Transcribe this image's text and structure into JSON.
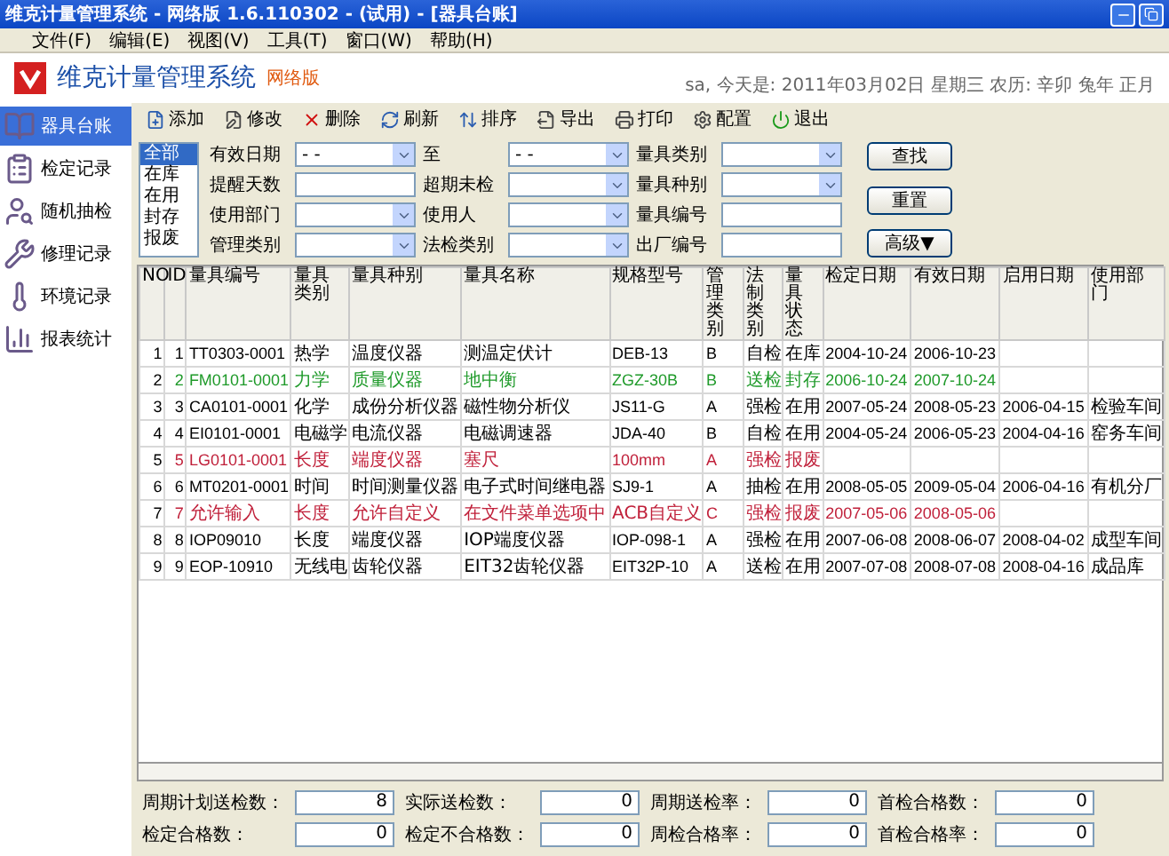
{
  "window": {
    "title": "维克计量管理系统 - 网络版 1.6.110302 - (试用) - [器具台账]"
  },
  "menu": [
    "文件(F)",
    "编辑(E)",
    "视图(V)",
    "工具(T)",
    "窗口(W)",
    "帮助(H)"
  ],
  "header": {
    "app_name": "维克计量管理系统",
    "edition": "网络版",
    "today": "sa, 今天是: 2011年03月02日 星期三  农历: 辛卯 兔年 正月"
  },
  "sidebar": [
    {
      "label": "器具台账",
      "selected": true
    },
    {
      "label": "检定记录",
      "selected": false
    },
    {
      "label": "随机抽检",
      "selected": false
    },
    {
      "label": "修理记录",
      "selected": false
    },
    {
      "label": "环境记录",
      "selected": false
    },
    {
      "label": "报表统计",
      "selected": false
    }
  ],
  "toolbar": [
    "添加",
    "修改",
    "删除",
    "刷新",
    "排序",
    "导出",
    "打印",
    "配置",
    "退出"
  ],
  "status_filter": [
    {
      "label": "全部",
      "selected": true
    },
    {
      "label": "在库",
      "selected": false
    },
    {
      "label": "在用",
      "selected": false
    },
    {
      "label": "封存",
      "selected": false
    },
    {
      "label": "报废",
      "selected": false
    }
  ],
  "filters": [
    {
      "label": "有效日期",
      "kind": "select",
      "value": "-  -"
    },
    {
      "label": "至",
      "kind": "select",
      "value": "-  -"
    },
    {
      "label": "量具类别",
      "kind": "select"
    },
    {
      "label": "提醒天数",
      "kind": "input"
    },
    {
      "label": "超期未检",
      "kind": "select"
    },
    {
      "label": "量具种别",
      "kind": "select"
    },
    {
      "label": "使用部门",
      "kind": "select"
    },
    {
      "label": "使用人",
      "kind": "select"
    },
    {
      "label": "量具编号",
      "kind": "input"
    },
    {
      "label": "管理类别",
      "kind": "select"
    },
    {
      "label": "法检类别",
      "kind": "select"
    },
    {
      "label": "出厂编号",
      "kind": "input"
    }
  ],
  "actions": [
    "查找",
    "重置",
    "高级▼"
  ],
  "table": {
    "columns": [
      "NO",
      "ID",
      "量具编号",
      "量具类别",
      "量具种别",
      "量具名称",
      "规格型号",
      "管理类别",
      "法制类别",
      "量具状态",
      "检定日期",
      "有效日期",
      "启用日期",
      "使用部门"
    ],
    "rows": [
      {
        "cells": [
          "1",
          "1",
          "TT0303-0001",
          "热学",
          "温度仪器",
          "测温定伏计",
          "DEB-13",
          "B",
          "自检",
          "在库",
          "2004-10-24",
          "2006-10-23",
          null,
          null
        ]
      },
      {
        "color": "#1f9a2a",
        "cells": [
          "2",
          "2",
          "FM0101-0001",
          "力学",
          "质量仪器",
          "地中衡",
          "ZGZ-30B",
          "B",
          "送检",
          "封存",
          "2006-10-24",
          "2007-10-24",
          null,
          null
        ]
      },
      {
        "cells": [
          "3",
          "3",
          "CA0101-0001",
          "化学",
          "成份分析仪器",
          "磁性物分析仪",
          "JS11-G",
          "A",
          "强检",
          "在用",
          "2007-05-24",
          "2008-05-23",
          "2006-04-15",
          "检验车间"
        ]
      },
      {
        "cells": [
          "4",
          "4",
          "EI0101-0001",
          "电磁学",
          "电流仪器",
          "电磁调速器",
          "JDA-40",
          "B",
          "自检",
          "在用",
          "2004-05-24",
          "2006-05-23",
          "2004-04-16",
          "窑务车间"
        ]
      },
      {
        "color": "#c0203a",
        "cells": [
          "5",
          "5",
          "LG0101-0001",
          "长度",
          "端度仪器",
          "塞尺",
          "100mm",
          "A",
          "强检",
          "报废",
          null,
          null,
          null,
          null
        ]
      },
      {
        "cells": [
          "6",
          "6",
          "MT0201-0001",
          "时间",
          "时间测量仪器",
          "电子式时间继电器",
          "SJ9-1",
          "A",
          "抽检",
          "在用",
          "2008-05-05",
          "2009-05-04",
          "2006-04-16",
          "有机分厂"
        ]
      },
      {
        "color": "#c0203a",
        "cells": [
          "7",
          "7",
          "允许输入",
          "长度",
          "允许自定义",
          "在文件菜单选项中",
          "ACB自定义",
          "C",
          "强检",
          "报废",
          "2007-05-06",
          "2008-05-06",
          null,
          null
        ]
      },
      {
        "cells": [
          "8",
          "8",
          "IOP09010",
          "长度",
          "端度仪器",
          "IOP端度仪器",
          "IOP-098-1",
          "A",
          "强检",
          "在用",
          "2007-06-08",
          "2008-06-07",
          "2008-04-02",
          "成型车间"
        ]
      },
      {
        "cells": [
          "9",
          "9",
          "EOP-10910",
          "无线电",
          "齿轮仪器",
          "EIT32齿轮仪器",
          "EIT32P-10",
          "A",
          "送检",
          "在用",
          "2007-07-08",
          "2008-07-08",
          "2008-04-16",
          "成品库"
        ]
      }
    ]
  },
  "stats": [
    {
      "label": "周期计划送检数：",
      "value": "8"
    },
    {
      "label": "实际送检数：",
      "value": "0"
    },
    {
      "label": "周期送检率：",
      "value": "0"
    },
    {
      "label": "首检合格数：",
      "value": "0"
    },
    {
      "label": "检定合格数：",
      "value": "0"
    },
    {
      "label": "检定不合格数：",
      "value": "0"
    },
    {
      "label": "周检合格率：",
      "value": "0"
    },
    {
      "label": "首检合格率：",
      "value": "0"
    }
  ]
}
